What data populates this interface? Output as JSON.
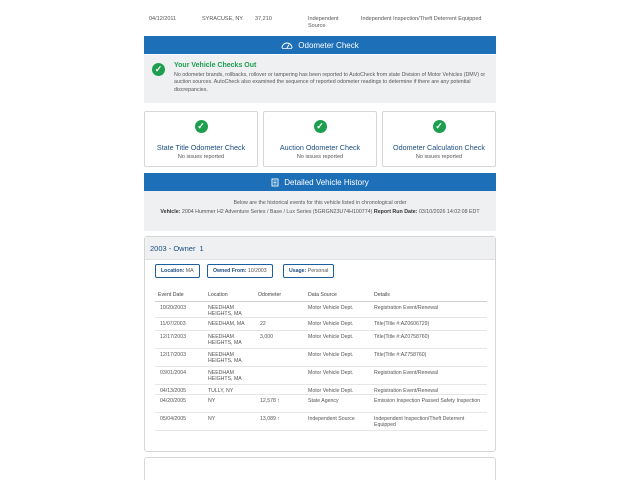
{
  "top_row": {
    "date": "04/12/2011",
    "location": "SYRACUSE, NY",
    "odometer": "37,210",
    "source": "Independent Source",
    "details": "Independent Inspection/Theft Deterrent Equipped"
  },
  "odometer_check": {
    "title": "Odometer Check",
    "icon": "speedometer-icon",
    "summary_title": "Your Vehicle Checks Out",
    "summary_text": "No odometer brands, rollbacks, rollover or tampering has been reported to AutoCheck from state Division of Motor Vehicles (DMV) or auction sources. AutoCheck also examined the sequence of reported odometer readings to determine if there are any potential discrepancies.",
    "cards": [
      {
        "title": "State Title Odometer Check",
        "status": "No issues reported"
      },
      {
        "title": "Auction Odometer Check",
        "status": "No issues reported"
      },
      {
        "title": "Odometer Calculation Check",
        "status": "No issues reported"
      }
    ]
  },
  "history": {
    "title": "Detailed Vehicle History",
    "icon": "document-icon",
    "intro": "Below are the historical events for this vehicle listed in chronological order",
    "vehicle_label": "Vehicle:",
    "vehicle_value": "2004 Hummer H2 Adventure Series / Base / Lux Series (5GRGN23U74H100774)",
    "run_date_label": "Report Run Date:",
    "run_date_value": "03/10/2026 14:02:08 EDT"
  },
  "owner": {
    "title": "2003 - Owner",
    "number": "1",
    "pills": [
      {
        "label": "Location:",
        "value": "MA"
      },
      {
        "label": "Owned From:",
        "value": "10/2003"
      },
      {
        "label": "Usage:",
        "value": "Personal"
      }
    ],
    "columns": [
      "Event Date",
      "Location",
      "Odometer",
      "Data Source",
      "Details"
    ],
    "rows": [
      {
        "date": "10/20/2003",
        "location": "NEEDHAM HEIGHTS, MA",
        "odometer": "",
        "source": "Motor Vehicle Dept.",
        "details": "Registration Event/Renewal"
      },
      {
        "date": "11/07/2003",
        "location": "NEEDHAM, MA",
        "odometer": "22",
        "source": "Motor Vehicle Dept.",
        "details": "Title(Title #:AZ0606729)"
      },
      {
        "date": "12/17/2003",
        "location": "NEEDHAM HEIGHTS, MA",
        "odometer": "3,000",
        "source": "Motor Vehicle Dept.",
        "details": "Title(Title #:AZ0758760)"
      },
      {
        "date": "12/17/2003",
        "location": "NEEDHAM HEIGHTS, MA",
        "odometer": "",
        "source": "Motor Vehicle Dept.",
        "details": "Title(Title #:AZ758760)"
      },
      {
        "date": "03/01/2004",
        "location": "NEEDHAM HEIGHTS, MA",
        "odometer": "",
        "source": "Motor Vehicle Dept.",
        "details": "Registration Event/Renewal"
      },
      {
        "date": "04/13/2005",
        "location": "TULLY, NY",
        "odometer": "",
        "source": "Motor Vehicle Dept.",
        "details": "Registration Event/Renewal"
      },
      {
        "date": "04/20/2005",
        "location": "NY",
        "odometer": "12,578 ↑",
        "source": "State Agency",
        "details": "Emission Inspection Passed Safety Inspection"
      },
      {
        "date": "05/04/2005",
        "location": "NY",
        "odometer": "13,089 ↑",
        "source": "Independent Source",
        "details": "Independent Inspection/Theft Deterrent Equipped"
      }
    ]
  },
  "colors": {
    "primary": "#1d6fb8",
    "success": "#1e9e4f",
    "link": "#1a4d80",
    "panel": "#eef0f2"
  }
}
